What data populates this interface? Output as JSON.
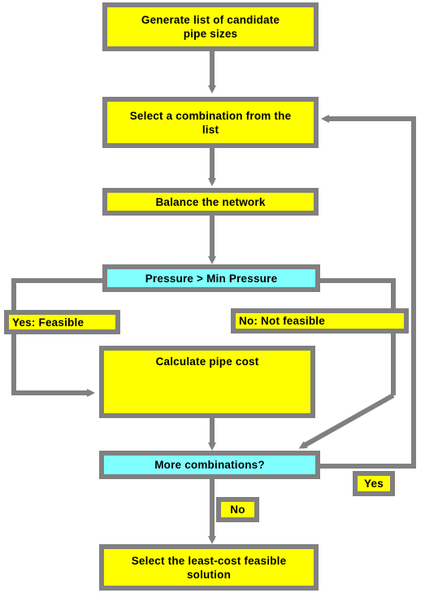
{
  "diagram": {
    "title": "Pipe sizing optimization flowchart",
    "colors": {
      "process_fill": "#ffff00",
      "decision_fill": "#00ffff",
      "border": "#808080",
      "connector": "#808080",
      "text": "#000000",
      "background": "#ffffff"
    },
    "nodes": [
      {
        "id": "generate",
        "label": "Generate list of candidate\npipe sizes",
        "type": "process"
      },
      {
        "id": "select",
        "label": "Select a combination from the\nlist",
        "type": "process"
      },
      {
        "id": "balance",
        "label": "Balance the network",
        "type": "process"
      },
      {
        "id": "pressure",
        "label": "Pressure > Min Pressure",
        "type": "decision"
      },
      {
        "id": "yes_feasible",
        "label": "Yes: Feasible",
        "type": "label"
      },
      {
        "id": "no_feasible",
        "label": "No: Not feasible",
        "type": "label"
      },
      {
        "id": "calc",
        "label": "Calculate pipe cost",
        "type": "process"
      },
      {
        "id": "more",
        "label": "More combinations?",
        "type": "decision"
      },
      {
        "id": "yes",
        "label": "Yes",
        "type": "label"
      },
      {
        "id": "no",
        "label": "No",
        "type": "label"
      },
      {
        "id": "final",
        "label": "Select the least-cost feasible\nsolution",
        "type": "process"
      }
    ],
    "edges": [
      {
        "from": "generate",
        "to": "select",
        "label": ""
      },
      {
        "from": "select",
        "to": "balance",
        "label": ""
      },
      {
        "from": "balance",
        "to": "pressure",
        "label": ""
      },
      {
        "from": "pressure",
        "to": "calc",
        "label": "Yes: Feasible"
      },
      {
        "from": "pressure",
        "to": "more",
        "label": "No: Not feasible"
      },
      {
        "from": "calc",
        "to": "more",
        "label": ""
      },
      {
        "from": "more",
        "to": "select",
        "label": "Yes"
      },
      {
        "from": "more",
        "to": "final",
        "label": "No"
      }
    ]
  }
}
